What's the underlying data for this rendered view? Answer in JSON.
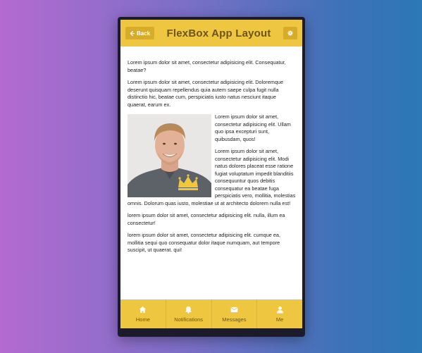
{
  "header": {
    "back_label": "Back",
    "title": "FlexBox App Layout"
  },
  "content": {
    "p1": "Lorem ipsum dolor sit amet, consectetur adipisicing elit. Consequatur, beatae?",
    "p2": "Lorem ipsum dolor sit amet, consectetur adipisicing elit. Doloremque deserunt quisquam repellendus quia autem saepe culpa fugit nulla distinctio hic, beatae cum, perspiciatis iusto natus nesciunt itaque quaerat, earum ex.",
    "p3": "Lorem ipsum dolor sit amet, consectetur adipisicing elit. Ullam quo ipsa excepturi sunt, quibusdam, quos!",
    "p4": "Lorem ipsum dolor sit amet, consectetur adipisicing elit. Modi natus dolores placeat esse ratione fugiat voluptatum impedit blanditiis consequuntur quos debitis consequatur ea beatae fuga perspiciatis vero, mollitia, molestias omnis. Dolorum quas iusto, molestiae ut at architecto dolorem nulla est!",
    "p5": "lorem ipsum dolor sit amet, consectetur adipisicing elit. nulla, illum ea consectetur!",
    "p6": "lorem ipsum dolor sit amet, consectetur adipisicing elit. cumque ea, mollitia sequi quo consequatur dolor itaque numquam, aut tempore suscipit, ut quaerat. qui!"
  },
  "tabs": [
    {
      "label": "Home",
      "icon": "home-icon"
    },
    {
      "label": "Notifications",
      "icon": "bell-icon"
    },
    {
      "label": "Messages",
      "icon": "envelope-icon"
    },
    {
      "label": "Me",
      "icon": "user-icon"
    }
  ],
  "colors": {
    "accent": "#efc63f",
    "accent_dark": "#d6ac2a",
    "text_dark": "#6b5616"
  }
}
